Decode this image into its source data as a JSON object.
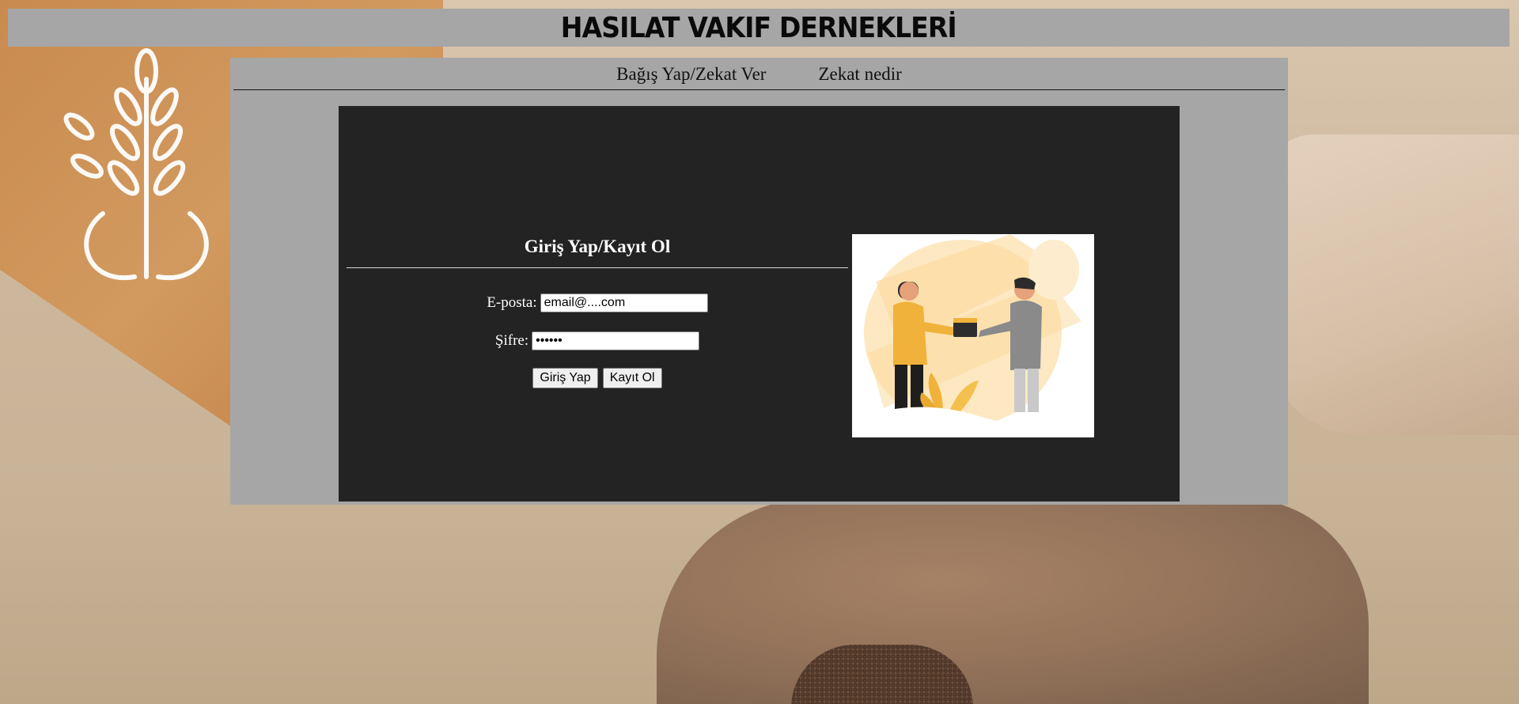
{
  "header": {
    "title": "HASILAT VAKIF DERNEKLERİ"
  },
  "nav": {
    "items": [
      {
        "label": "Bağış Yap/Zekat Ver"
      },
      {
        "label": "Zekat nedir"
      }
    ]
  },
  "login": {
    "title": "Giriş Yap/Kayıt Ol",
    "email_label": "E-posta:",
    "email_value": "email@....com",
    "password_label": "Şifre:",
    "password_value": "••••••",
    "login_button": "Giriş Yap",
    "register_button": "Kayıt Ol"
  },
  "colors": {
    "panel_gray": "#a6a6a6",
    "dark_box": "#232323",
    "illustration_accent": "#f0b23a"
  }
}
